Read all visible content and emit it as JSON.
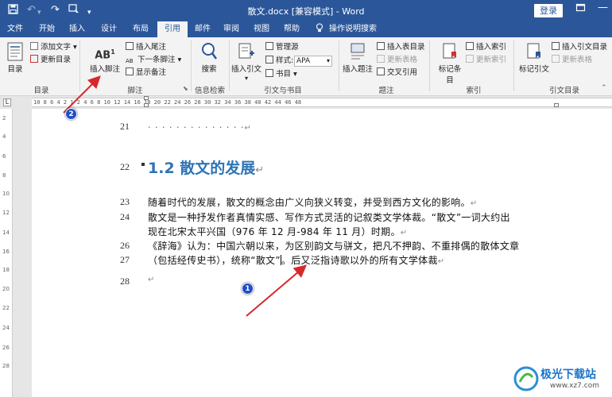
{
  "titlebar": {
    "title": "散文.docx [兼容模式] - Word",
    "login_label": "登录",
    "save_icon": "save-icon",
    "undo_icon": "undo-icon",
    "redo_icon": "redo-icon",
    "customize_icon": "customize-icon",
    "restore_icon": "restore-icon",
    "minimize_icon": "minimize-icon"
  },
  "tabs": [
    {
      "label": "文件"
    },
    {
      "label": "开始"
    },
    {
      "label": "插入"
    },
    {
      "label": "设计"
    },
    {
      "label": "布局"
    },
    {
      "label": "引用",
      "active": true
    },
    {
      "label": "邮件"
    },
    {
      "label": "审阅"
    },
    {
      "label": "视图"
    },
    {
      "label": "帮助"
    },
    {
      "label": "操作说明搜索"
    }
  ],
  "ribbon": {
    "toc": {
      "big": "目录",
      "add_text": "添加文字",
      "update": "更新目录",
      "group": "目录"
    },
    "footnote": {
      "big": "插入脚注",
      "insert_endnote": "插入尾注",
      "next_footnote": "下一条脚注",
      "show_notes": "显示备注",
      "group": "脚注",
      "ab_label": "AB",
      "ab_sup": "1"
    },
    "search": {
      "big": "搜索",
      "group": "信息检索"
    },
    "citation": {
      "big": "插入引文",
      "manage": "管理源",
      "style_label": "样式:",
      "style_value": "APA",
      "bibliography": "书目",
      "group": "引文与书目"
    },
    "caption": {
      "big": "插入题注",
      "insert_table": "插入表目录",
      "update_table": "更新表格",
      "cross_ref": "交叉引用",
      "group": "题注"
    },
    "index": {
      "big": "标记条目",
      "insert_index": "插入索引",
      "update_index": "更新索引",
      "group": "索引"
    },
    "authorities": {
      "big": "标记引文",
      "insert_table": "插入引文目录",
      "update_table": "更新表格",
      "group": "引文目录"
    }
  },
  "ruler": {
    "text": "10 8 6 4 2 1  2 4 6 8 10 12 14 16 18 20 22 24 26 28 30 32 34 36 38 40 42 44 46 48",
    "vnums": [
      "2",
      "4",
      "6",
      "8",
      "10",
      "12",
      "14",
      "16",
      "18",
      "20",
      "22",
      "24",
      "26",
      "28"
    ]
  },
  "document": {
    "line21": {
      "num": "21",
      "text": "· · · · · · · · · · · · · ·"
    },
    "line22": {
      "num": "22",
      "heading": "1.2 散文的发展"
    },
    "lines": [
      {
        "num": "23",
        "text": "随着时代的发展，散文的概念由广义向狭义转变，并受到西方文化的影响。"
      },
      {
        "num": "24",
        "text": "散文是一种抒发作者真情实感、写作方式灵活的记叙类文学体裁。“散文”一词大约出"
      },
      {
        "num": "",
        "text": "现在北宋太平兴国（976 年 12 月-984 年 11 月）时期。"
      },
      {
        "num": "26",
        "text": "《辞海》认为：中国六朝以来，为区别韵文与骈文，把凡不押韵、不重排偶的散体文章"
      },
      {
        "num": "27",
        "text_before": "（包括经传史书），统称“散文”",
        "text_after": "。后又泛指诗歌以外的所有文学体裁"
      }
    ],
    "line28": {
      "num": "28"
    },
    "para_mark": "↵"
  },
  "annotations": {
    "badge1": "1",
    "badge2": "2"
  },
  "watermark": {
    "name": "极光下载站",
    "url": "www.xz7.com"
  }
}
